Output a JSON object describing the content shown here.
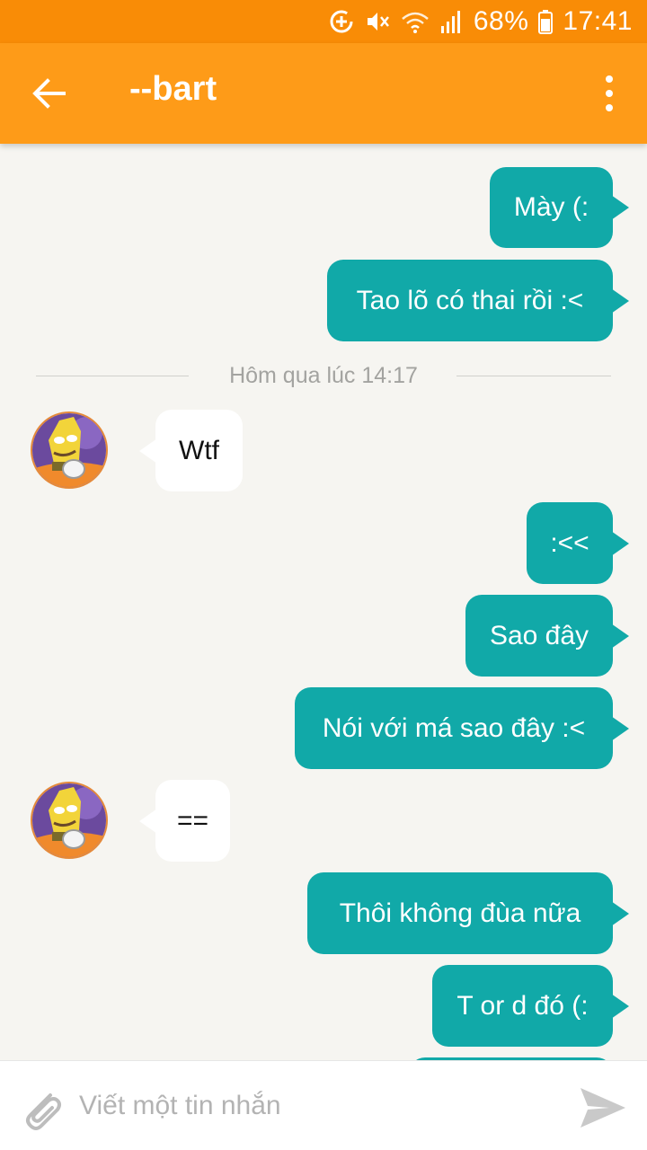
{
  "status_bar": {
    "battery_percent": "68%",
    "time": "17:41",
    "icons": [
      "data-saver-icon",
      "mute-icon",
      "wifi-icon",
      "signal-icon",
      "battery-icon"
    ]
  },
  "app_bar": {
    "title": "--bart",
    "back_icon": "arrow-left-icon",
    "menu_icon": "more-vertical-icon"
  },
  "colors": {
    "status_bar": "#f98c06",
    "app_bar": "#fe9b18",
    "outgoing_bubble": "#11a9a8",
    "incoming_bubble": "#ffffff",
    "background": "#f6f5f1"
  },
  "messages": [
    {
      "direction": "out",
      "text": "Mày (:"
    },
    {
      "direction": "out",
      "text": "Tao lõ có thai rồi :<"
    },
    {
      "direction": "separator",
      "text": "Hôm qua lúc 14:17"
    },
    {
      "direction": "in",
      "text": "Wtf"
    },
    {
      "direction": "out",
      "text": ":<<"
    },
    {
      "direction": "out",
      "text": "Sao đây"
    },
    {
      "direction": "out",
      "text": "Nói với má sao đây :<"
    },
    {
      "direction": "in",
      "text": "=="
    },
    {
      "direction": "out",
      "text": "Thôi không đùa nữa"
    },
    {
      "direction": "out",
      "text": "T or d đó (:"
    }
  ],
  "composer": {
    "placeholder": "Viết một tin nhắn",
    "attach_icon": "paperclip-icon",
    "send_icon": "send-icon"
  }
}
